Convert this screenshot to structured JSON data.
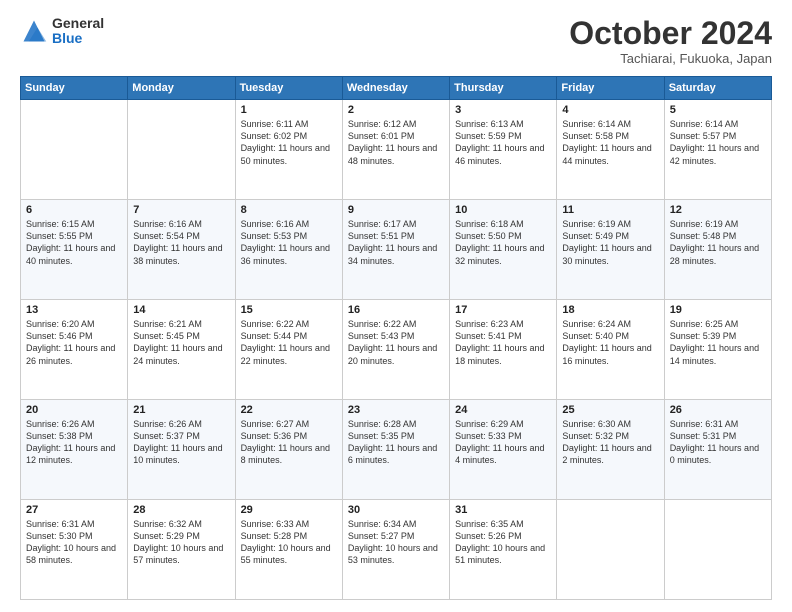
{
  "logo": {
    "general": "General",
    "blue": "Blue"
  },
  "header": {
    "month": "October 2024",
    "location": "Tachiarai, Fukuoka, Japan"
  },
  "weekdays": [
    "Sunday",
    "Monday",
    "Tuesday",
    "Wednesday",
    "Thursday",
    "Friday",
    "Saturday"
  ],
  "weeks": [
    [
      {
        "day": "",
        "info": ""
      },
      {
        "day": "",
        "info": ""
      },
      {
        "day": "1",
        "info": "Sunrise: 6:11 AM\nSunset: 6:02 PM\nDaylight: 11 hours and 50 minutes."
      },
      {
        "day": "2",
        "info": "Sunrise: 6:12 AM\nSunset: 6:01 PM\nDaylight: 11 hours and 48 minutes."
      },
      {
        "day": "3",
        "info": "Sunrise: 6:13 AM\nSunset: 5:59 PM\nDaylight: 11 hours and 46 minutes."
      },
      {
        "day": "4",
        "info": "Sunrise: 6:14 AM\nSunset: 5:58 PM\nDaylight: 11 hours and 44 minutes."
      },
      {
        "day": "5",
        "info": "Sunrise: 6:14 AM\nSunset: 5:57 PM\nDaylight: 11 hours and 42 minutes."
      }
    ],
    [
      {
        "day": "6",
        "info": "Sunrise: 6:15 AM\nSunset: 5:55 PM\nDaylight: 11 hours and 40 minutes."
      },
      {
        "day": "7",
        "info": "Sunrise: 6:16 AM\nSunset: 5:54 PM\nDaylight: 11 hours and 38 minutes."
      },
      {
        "day": "8",
        "info": "Sunrise: 6:16 AM\nSunset: 5:53 PM\nDaylight: 11 hours and 36 minutes."
      },
      {
        "day": "9",
        "info": "Sunrise: 6:17 AM\nSunset: 5:51 PM\nDaylight: 11 hours and 34 minutes."
      },
      {
        "day": "10",
        "info": "Sunrise: 6:18 AM\nSunset: 5:50 PM\nDaylight: 11 hours and 32 minutes."
      },
      {
        "day": "11",
        "info": "Sunrise: 6:19 AM\nSunset: 5:49 PM\nDaylight: 11 hours and 30 minutes."
      },
      {
        "day": "12",
        "info": "Sunrise: 6:19 AM\nSunset: 5:48 PM\nDaylight: 11 hours and 28 minutes."
      }
    ],
    [
      {
        "day": "13",
        "info": "Sunrise: 6:20 AM\nSunset: 5:46 PM\nDaylight: 11 hours and 26 minutes."
      },
      {
        "day": "14",
        "info": "Sunrise: 6:21 AM\nSunset: 5:45 PM\nDaylight: 11 hours and 24 minutes."
      },
      {
        "day": "15",
        "info": "Sunrise: 6:22 AM\nSunset: 5:44 PM\nDaylight: 11 hours and 22 minutes."
      },
      {
        "day": "16",
        "info": "Sunrise: 6:22 AM\nSunset: 5:43 PM\nDaylight: 11 hours and 20 minutes."
      },
      {
        "day": "17",
        "info": "Sunrise: 6:23 AM\nSunset: 5:41 PM\nDaylight: 11 hours and 18 minutes."
      },
      {
        "day": "18",
        "info": "Sunrise: 6:24 AM\nSunset: 5:40 PM\nDaylight: 11 hours and 16 minutes."
      },
      {
        "day": "19",
        "info": "Sunrise: 6:25 AM\nSunset: 5:39 PM\nDaylight: 11 hours and 14 minutes."
      }
    ],
    [
      {
        "day": "20",
        "info": "Sunrise: 6:26 AM\nSunset: 5:38 PM\nDaylight: 11 hours and 12 minutes."
      },
      {
        "day": "21",
        "info": "Sunrise: 6:26 AM\nSunset: 5:37 PM\nDaylight: 11 hours and 10 minutes."
      },
      {
        "day": "22",
        "info": "Sunrise: 6:27 AM\nSunset: 5:36 PM\nDaylight: 11 hours and 8 minutes."
      },
      {
        "day": "23",
        "info": "Sunrise: 6:28 AM\nSunset: 5:35 PM\nDaylight: 11 hours and 6 minutes."
      },
      {
        "day": "24",
        "info": "Sunrise: 6:29 AM\nSunset: 5:33 PM\nDaylight: 11 hours and 4 minutes."
      },
      {
        "day": "25",
        "info": "Sunrise: 6:30 AM\nSunset: 5:32 PM\nDaylight: 11 hours and 2 minutes."
      },
      {
        "day": "26",
        "info": "Sunrise: 6:31 AM\nSunset: 5:31 PM\nDaylight: 11 hours and 0 minutes."
      }
    ],
    [
      {
        "day": "27",
        "info": "Sunrise: 6:31 AM\nSunset: 5:30 PM\nDaylight: 10 hours and 58 minutes."
      },
      {
        "day": "28",
        "info": "Sunrise: 6:32 AM\nSunset: 5:29 PM\nDaylight: 10 hours and 57 minutes."
      },
      {
        "day": "29",
        "info": "Sunrise: 6:33 AM\nSunset: 5:28 PM\nDaylight: 10 hours and 55 minutes."
      },
      {
        "day": "30",
        "info": "Sunrise: 6:34 AM\nSunset: 5:27 PM\nDaylight: 10 hours and 53 minutes."
      },
      {
        "day": "31",
        "info": "Sunrise: 6:35 AM\nSunset: 5:26 PM\nDaylight: 10 hours and 51 minutes."
      },
      {
        "day": "",
        "info": ""
      },
      {
        "day": "",
        "info": ""
      }
    ]
  ]
}
